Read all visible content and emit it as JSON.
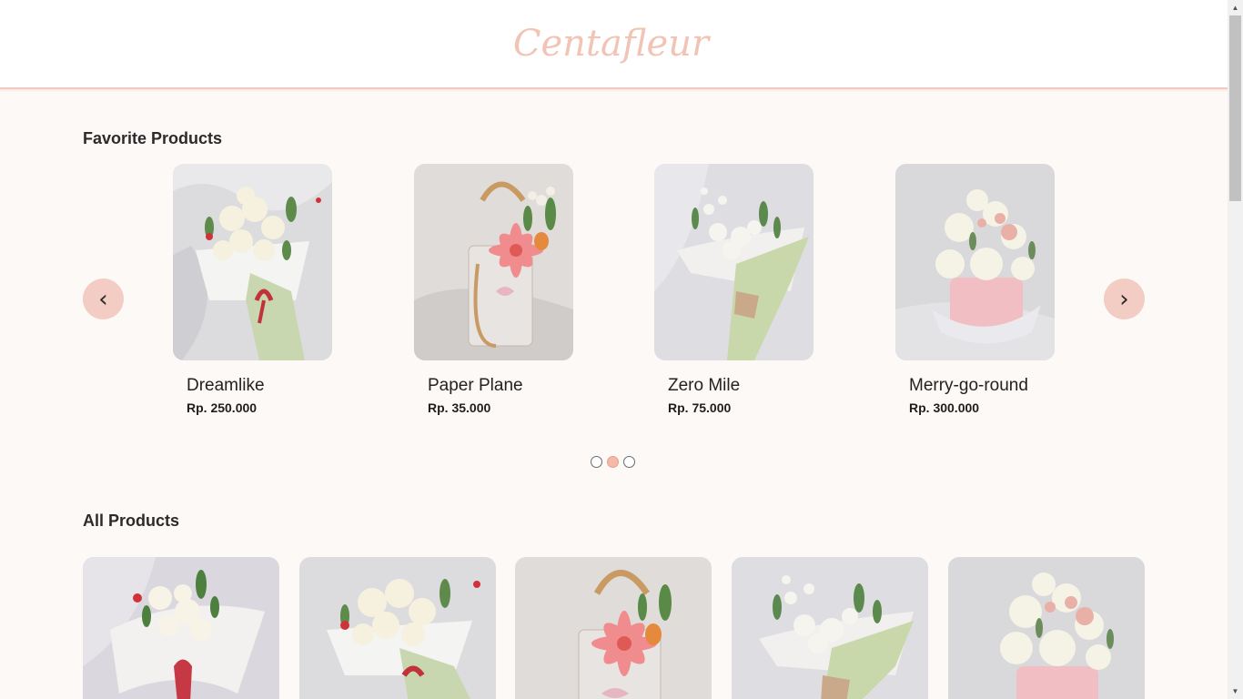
{
  "header": {
    "logo": "Centafleur"
  },
  "favorites": {
    "title": "Favorite Products",
    "items": [
      {
        "name": "Dreamlike",
        "price": "Rp. 250.000",
        "image": "white-rose-bouquet-green-wrap"
      },
      {
        "name": "Paper Plane",
        "price": "Rp. 35.000",
        "image": "pink-gerbera-clear-bag"
      },
      {
        "name": "Zero Mile",
        "price": "Rp. 75.000",
        "image": "white-flowers-green-wrap"
      },
      {
        "name": "Merry-go-round",
        "price": "Rp. 300.000",
        "image": "mixed-flower-box"
      }
    ],
    "prev_icon": "‹",
    "next_icon": "›",
    "pagination": {
      "pages": 3,
      "active": 2
    }
  },
  "all_products": {
    "title": "All Products",
    "items": [
      {
        "image": "white-rose-red-ribbon"
      },
      {
        "image": "white-rose-bouquet-green-wrap"
      },
      {
        "image": "pink-gerbera-clear-bag"
      },
      {
        "image": "white-flowers-green-wrap"
      },
      {
        "image": "mixed-flower-box"
      }
    ]
  },
  "colors": {
    "accent": "#f3cdc3",
    "logo": "#f1c4b5",
    "background": "#fdf9f7"
  }
}
